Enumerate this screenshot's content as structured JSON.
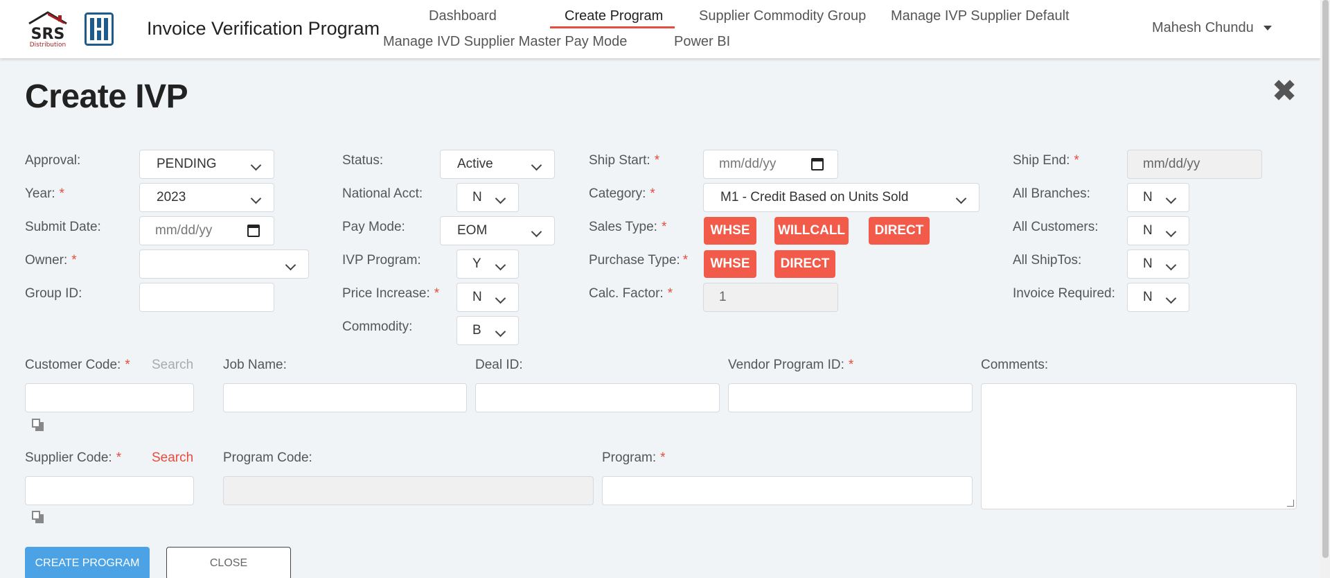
{
  "header": {
    "app_title": "Invoice Verification Program",
    "logo_text": "SRS Distribution",
    "nav": [
      "Dashboard",
      "Create Program",
      "Supplier Commodity Group",
      "Manage IVP Supplier Default",
      "Manage IVD Supplier Master Pay Mode",
      "Power BI"
    ],
    "user": "Mahesh Chundu"
  },
  "page": {
    "title": "Create IVP"
  },
  "form": {
    "approval": {
      "label": "Approval:",
      "value": "PENDING"
    },
    "year": {
      "label": "Year:",
      "value": "2023"
    },
    "submit_date": {
      "label": "Submit Date:",
      "placeholder": "mm/dd/yy"
    },
    "owner": {
      "label": "Owner:",
      "value": ""
    },
    "group_id": {
      "label": "Group ID:",
      "value": ""
    },
    "status": {
      "label": "Status:",
      "value": "Active"
    },
    "national_acct": {
      "label": "National Acct:",
      "value": "N"
    },
    "pay_mode": {
      "label": "Pay Mode:",
      "value": "EOM"
    },
    "ivp_program": {
      "label": "IVP Program:",
      "value": "Y"
    },
    "price_increase": {
      "label": "Price Increase:",
      "value": "N"
    },
    "commodity": {
      "label": "Commodity:",
      "value": "B"
    },
    "ship_start": {
      "label": "Ship Start:",
      "placeholder": "mm/dd/yy"
    },
    "category": {
      "label": "Category:",
      "value": "M1 - Credit Based on Units Sold"
    },
    "sales_type": {
      "label": "Sales Type:",
      "chips": [
        "WHSE",
        "WILLCALL",
        "DIRECT"
      ]
    },
    "purchase_type": {
      "label": "Purchase Type:",
      "chips": [
        "WHSE",
        "DIRECT"
      ]
    },
    "calc_factor": {
      "label": "Calc. Factor:",
      "value": "1"
    },
    "ship_end": {
      "label": "Ship End:",
      "placeholder": "mm/dd/yy"
    },
    "all_branches": {
      "label": "All Branches:",
      "value": "N"
    },
    "all_customers": {
      "label": "All Customers:",
      "value": "N"
    },
    "all_shiptos": {
      "label": "All ShipTos:",
      "value": "N"
    },
    "invoice_required": {
      "label": "Invoice Required:",
      "value": "N"
    },
    "customer_code": {
      "label": "Customer Code:",
      "search": "Search",
      "value": ""
    },
    "job_name": {
      "label": "Job Name:",
      "value": ""
    },
    "deal_id": {
      "label": "Deal ID:",
      "value": ""
    },
    "vendor_program_id": {
      "label": "Vendor Program ID:",
      "value": ""
    },
    "comments": {
      "label": "Comments:",
      "value": ""
    },
    "supplier_code": {
      "label": "Supplier Code:",
      "search": "Search",
      "value": ""
    },
    "program_code": {
      "label": "Program Code:",
      "value": ""
    },
    "program": {
      "label": "Program:",
      "value": ""
    },
    "required_marker": "*"
  },
  "actions": {
    "create": "CREATE PROGRAM",
    "close": "CLOSE"
  },
  "colors": {
    "accent": "#e74c3c",
    "chip": "#f25a4a",
    "primary_button": "#4ba3e6",
    "page_bg": "#f1f4f7"
  },
  "icons": [
    "srs-logo-icon",
    "h-logo-icon",
    "caret-down-icon",
    "close-icon",
    "calendar-icon",
    "chevron-down-icon",
    "copy-icon"
  ]
}
